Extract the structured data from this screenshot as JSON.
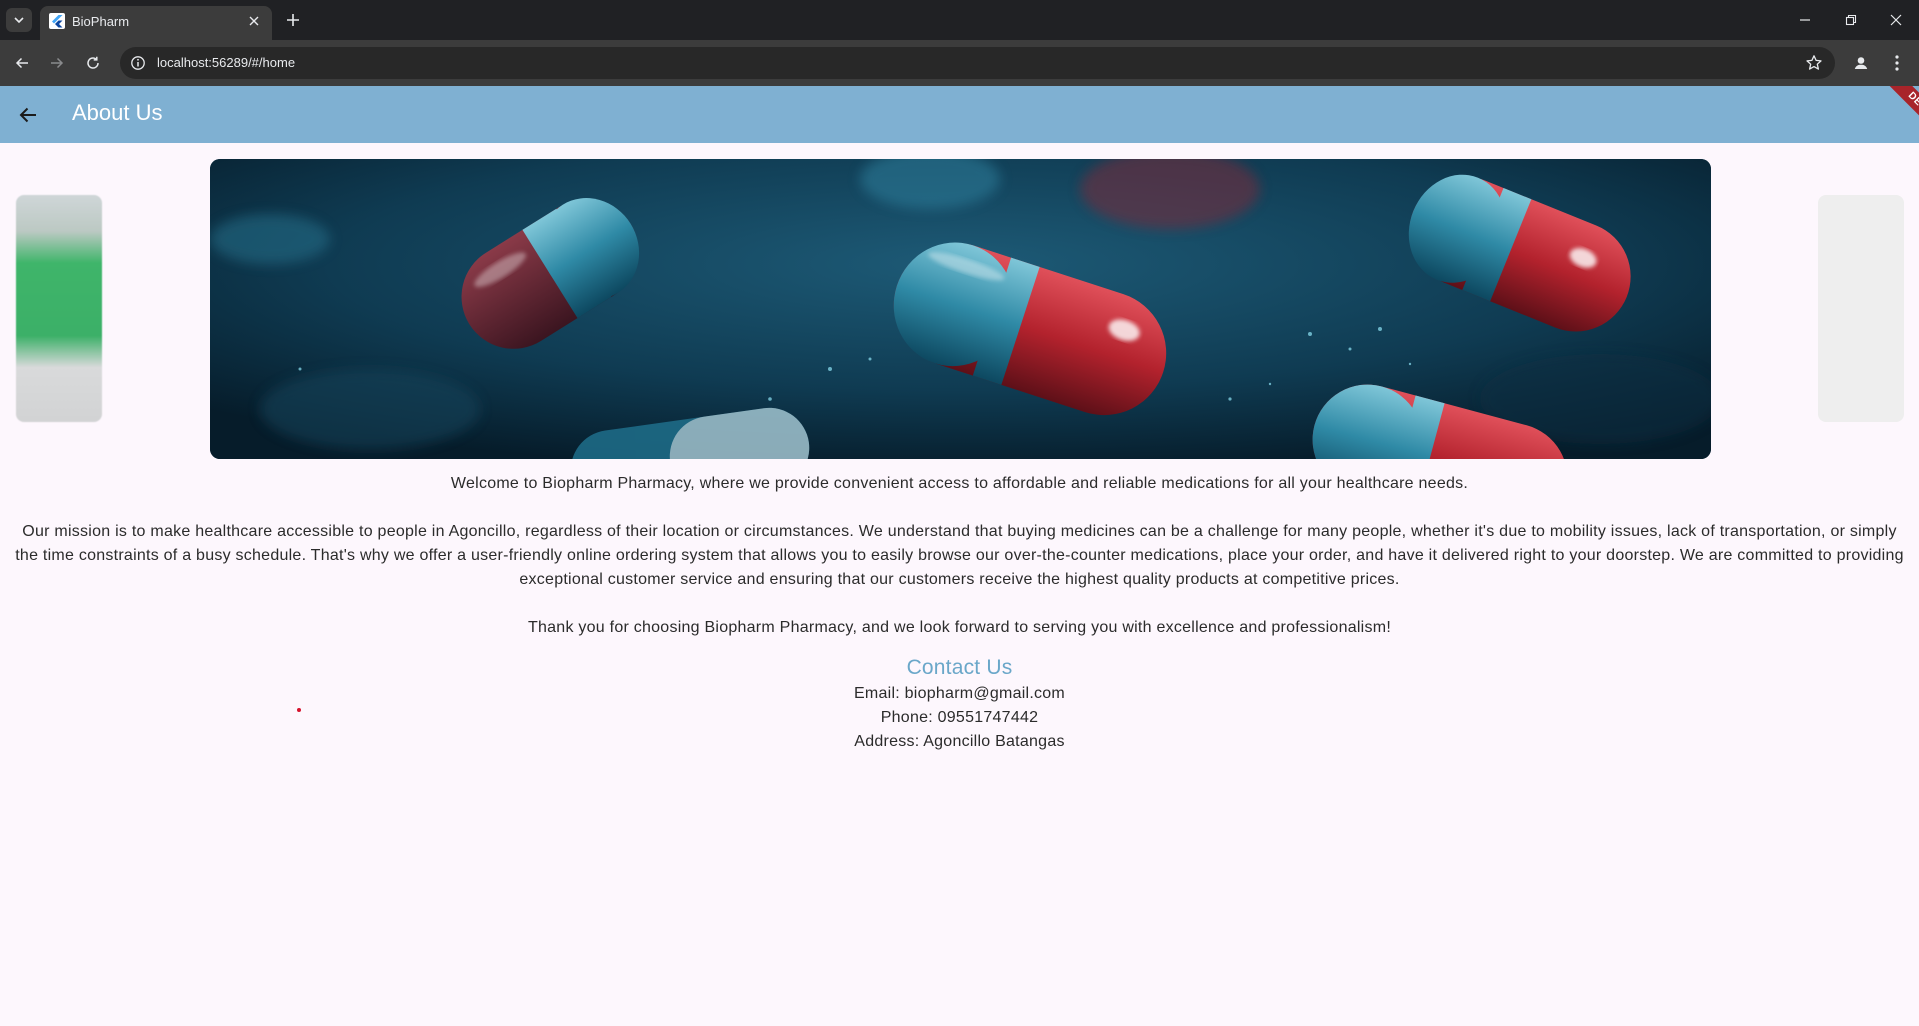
{
  "browser": {
    "tab_title": "BioPharm",
    "url": "localhost:56289/#/home"
  },
  "appbar": {
    "title": "About Us",
    "debug_label": "DEBUG",
    "color": "#7fb0d2"
  },
  "icons": {
    "back": "arrow-left-icon",
    "tab_menu": "chevron-down-icon",
    "new_tab": "plus-icon",
    "info": "info-icon",
    "bookmark": "star-icon",
    "profile": "person-icon",
    "menu": "kebab-icon"
  },
  "carousel": {
    "hero_alt": "Red and blue capsules",
    "accent": "#0d3347"
  },
  "about": {
    "welcome": "Welcome to Biopharm Pharmacy, where we provide convenient access to affordable and reliable medications for all your healthcare needs.",
    "mission": "Our mission is to make healthcare accessible to people in Agoncillo, regardless of their location or circumstances. We understand that buying medicines can be a challenge for many people, whether it's due to mobility issues, lack of transportation, or simply the time constraints of a busy schedule. That's why we offer a user-friendly online ordering system that allows you to easily browse our over-the-counter medications, place your order, and have it delivered right to your doorstep. We are committed to providing exceptional customer service and ensuring that our customers receive the highest quality products at competitive prices.",
    "thanks": "Thank you for choosing Biopharm Pharmacy, and we look forward to serving you with excellence and professionalism!"
  },
  "contact": {
    "title": "Contact Us",
    "title_color": "#6aa7c9",
    "email": "Email: biopharm@gmail.com",
    "phone": "Phone: 09551747442",
    "address": "Address: Agoncillo Batangas"
  }
}
